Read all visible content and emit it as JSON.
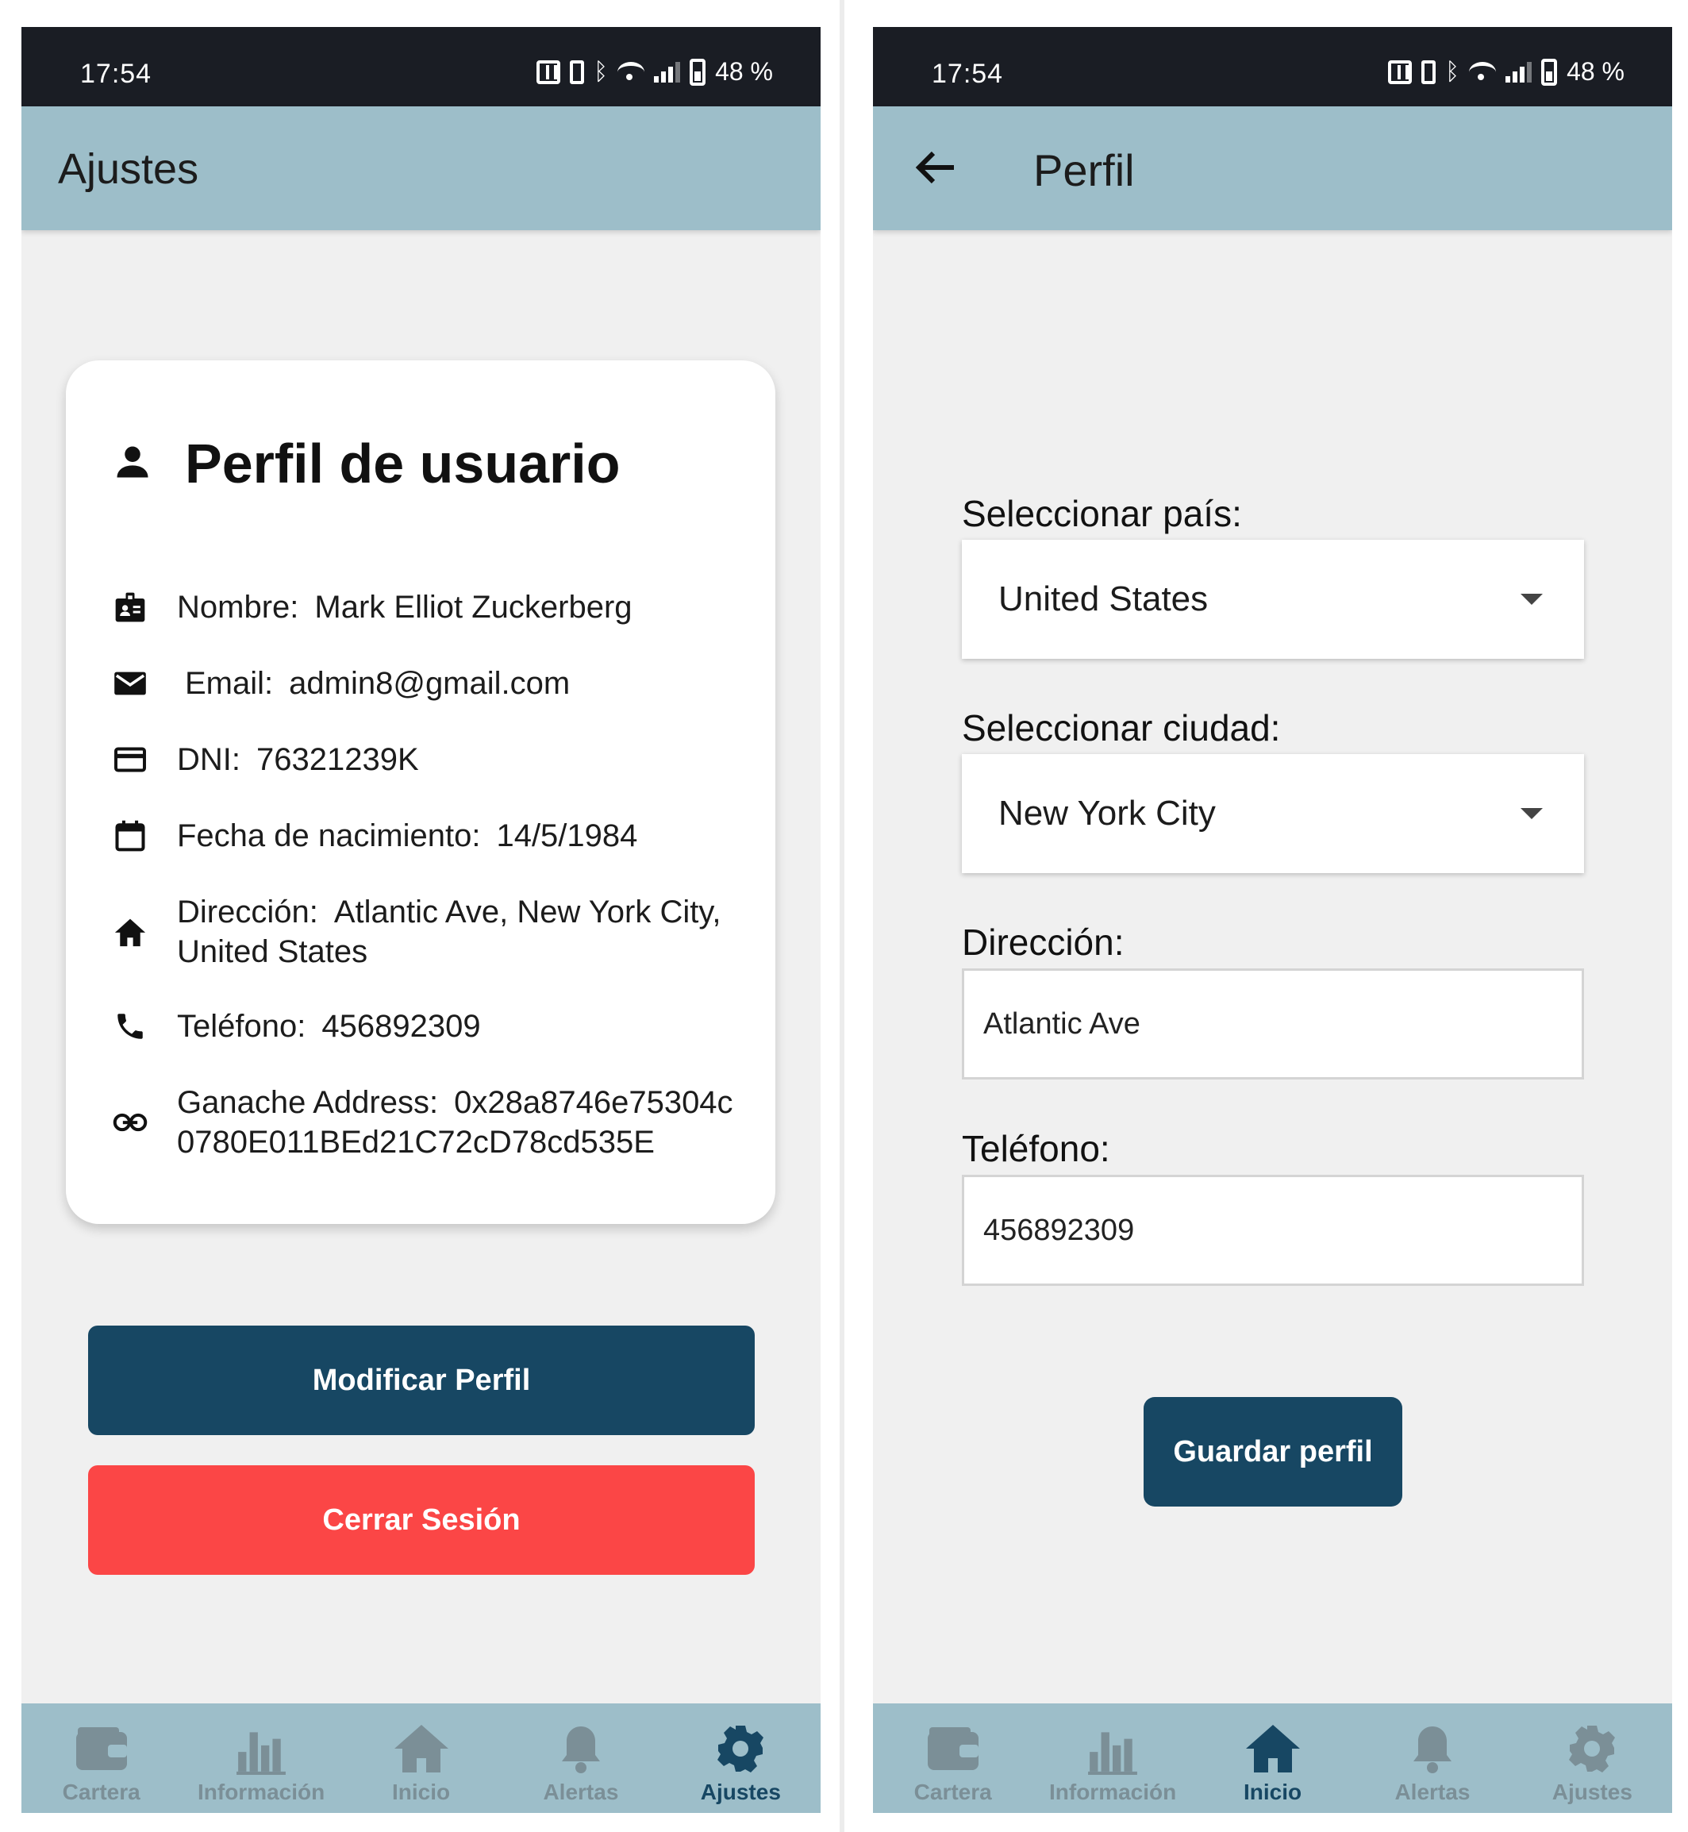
{
  "colors": {
    "app_bar": "#9dbec9",
    "status_bar": "#1a1d24",
    "primary": "#174763",
    "danger": "#fb4646",
    "nav_inactive": "#7b8f97",
    "background": "#f0f0f0"
  },
  "status": {
    "time": "17:54",
    "battery": "48 %"
  },
  "left": {
    "title": "Ajustes",
    "card": {
      "icon": "person-icon",
      "title": "Perfil de usuario",
      "rows": [
        {
          "icon": "badge-icon",
          "label": "Nombre:",
          "value": "Mark Elliot Zuckerberg"
        },
        {
          "icon": "mail-icon",
          "label": "Email:",
          "value": "admin8@gmail.com"
        },
        {
          "icon": "credit-card-icon",
          "label": "DNI:",
          "value": "76321239K"
        },
        {
          "icon": "calendar-icon",
          "label": "Fecha de nacimiento:",
          "value": "14/5/1984"
        },
        {
          "icon": "home-icon",
          "label": "Dirección:",
          "value": "Atlantic Ave, New York City,",
          "value2": "United States"
        },
        {
          "icon": "phone-icon",
          "label": "Teléfono:",
          "value": "456892309"
        },
        {
          "icon": "link-icon",
          "label": "Ganache Address:",
          "value": "0x28a8746e75304c",
          "value2": "0780E011BEd21C72cD78cd535E"
        }
      ]
    },
    "modify_button": "Modificar Perfil",
    "logout_button": "Cerrar Sesión"
  },
  "right": {
    "title": "Perfil",
    "country_label": "Seleccionar país:",
    "country_value": "United States",
    "city_label": "Seleccionar ciudad:",
    "city_value": "New York City",
    "address_label": "Dirección:",
    "address_value": "Atlantic Ave",
    "phone_label": "Teléfono:",
    "phone_value": "456892309",
    "save_button": "Guardar perfil"
  },
  "nav": {
    "items": [
      {
        "label": "Cartera",
        "icon": "wallet-icon"
      },
      {
        "label": "Información",
        "icon": "bar-chart-icon"
      },
      {
        "label": "Inicio",
        "icon": "home-icon"
      },
      {
        "label": "Alertas",
        "icon": "bell-icon"
      },
      {
        "label": "Ajustes",
        "icon": "gear-icon"
      }
    ],
    "left_active": "Ajustes",
    "right_active": "Inicio"
  }
}
